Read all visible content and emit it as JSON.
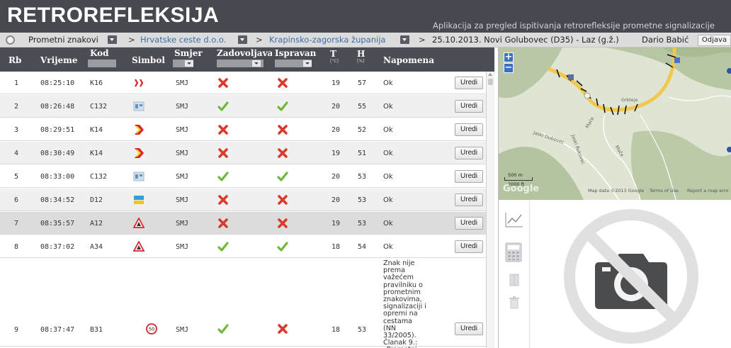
{
  "header": {
    "title": "RETROREFLEKSIJA",
    "subtitle": "Aplikacija za pregled ispitivanja retrorefleksije prometne signalizacije"
  },
  "breadcrumb": {
    "item1": "Prometni znakovi",
    "sep": ">",
    "item2": "Hrvatske ceste d.o.o.",
    "item3": "Krapinsko-zagorska županija",
    "item4": "25.10.2013. Novi Golubovec (D35) - Laz (g.ž.)",
    "user": "Dario Babić",
    "logout": "Odjava"
  },
  "table": {
    "columns": {
      "rb": "Rb",
      "vrijeme": "Vrijeme",
      "kod": "Kod",
      "simbol": "Simbol",
      "smjer": "Smjer",
      "zadovoljava": "Zadovoljava",
      "ispravan": "Ispravan",
      "t": "T",
      "t_unit": "[°C]",
      "h": "H",
      "h_unit": "[%]",
      "napomena": "Napomena"
    },
    "edit_label": "Uredi",
    "rows": [
      {
        "rb": "1",
        "time": "08:25:10",
        "code": "K16",
        "symbol": "chevron-red-white-icon",
        "dir": "SMJ",
        "ok": false,
        "valid": false,
        "t": "19",
        "h": "57",
        "note": "Ok"
      },
      {
        "rb": "2",
        "time": "08:26:48",
        "code": "C132",
        "symbol": "info-sign-icon",
        "dir": "SMJ",
        "ok": true,
        "valid": true,
        "t": "20",
        "h": "55",
        "note": "Ok"
      },
      {
        "rb": "3",
        "time": "08:29:51",
        "code": "K14",
        "symbol": "chevron-yellow-red-icon",
        "dir": "SMJ",
        "ok": false,
        "valid": false,
        "t": "20",
        "h": "52",
        "note": "Ok"
      },
      {
        "rb": "4",
        "time": "08:30:49",
        "code": "K14",
        "symbol": "chevron-yellow-red-icon",
        "dir": "SMJ",
        "ok": false,
        "valid": false,
        "t": "19",
        "h": "51",
        "note": "Ok"
      },
      {
        "rb": "5",
        "time": "08:33:00",
        "code": "C132",
        "symbol": "info-sign-icon",
        "dir": "SMJ",
        "ok": true,
        "valid": true,
        "t": "20",
        "h": "53",
        "note": "Ok"
      },
      {
        "rb": "6",
        "time": "08:34:52",
        "code": "D12",
        "symbol": "direction-sign-icon",
        "dir": "SMJ",
        "ok": false,
        "valid": false,
        "t": "20",
        "h": "53",
        "note": "Ok"
      },
      {
        "rb": "7",
        "time": "08:35:57",
        "code": "A12",
        "symbol": "warning-triangle-icon",
        "dir": "SMJ",
        "ok": false,
        "valid": false,
        "t": "19",
        "h": "53",
        "note": "Ok"
      },
      {
        "rb": "8",
        "time": "08:37:02",
        "code": "A34",
        "symbol": "warning-triangle-icon",
        "dir": "SMJ",
        "ok": true,
        "valid": true,
        "t": "18",
        "h": "54",
        "note": "Ok"
      },
      {
        "rb": "9",
        "time": "08:37:47",
        "code": "B31",
        "symbol": "speed-limit-icon",
        "speed": "50",
        "dir": "SMJ",
        "ok": true,
        "valid": false,
        "t": "18",
        "h": "53",
        "note": "Znak nije prema važećem pravilniku o prometnim znakovima, signalizaciji i opremi na cestama (NN 33/2005). Članak 9.: „Prometni"
      }
    ]
  },
  "map": {
    "scale_metric": "500 m",
    "scale_imperial": "2000 ft",
    "watermark": "Google",
    "attribution": "Map data ©2013 Google",
    "terms": "Terms of Use",
    "report": "Report a map erro",
    "labels": [
      "Grbleje",
      "Jaski Dubovec",
      "Mače",
      "Jaski Rukovec",
      "Mače"
    ]
  },
  "colors": {
    "header_bg": "#464950",
    "accent_link": "#3c6ea8",
    "fail": "#d93a2b",
    "pass": "#6fb83a"
  }
}
